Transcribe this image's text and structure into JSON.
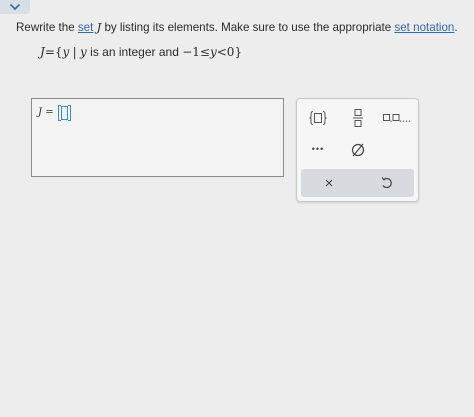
{
  "header": {
    "collapse_icon": "chevron-down-icon"
  },
  "prompt": {
    "part1": "Rewrite the ",
    "link_set": "set",
    "part2_var": "J",
    "part3": " by listing its elements. Make sure to use the appropriate ",
    "link_notation": "set notation",
    "part4": "."
  },
  "set_definition": {
    "lhs": "J",
    "eq": "=",
    "open": "{",
    "var": "y",
    "bar": "|",
    "var2": "y",
    "text": " is an integer and ",
    "ineq": "−1≤",
    "var3": "y",
    "ineq2": "<0",
    "close": "}"
  },
  "answer": {
    "label": "J ="
  },
  "palette": {
    "buttons": [
      "set-braces-icon",
      "fraction-icon",
      "list-icon",
      "ellipsis-icon",
      "empty-set-icon",
      "clear-icon",
      "undo-icon"
    ],
    "ellipsis": "•••",
    "clear": "×"
  },
  "colors": {
    "link": "#2f6aa8",
    "focus": "#3b8bd0"
  }
}
